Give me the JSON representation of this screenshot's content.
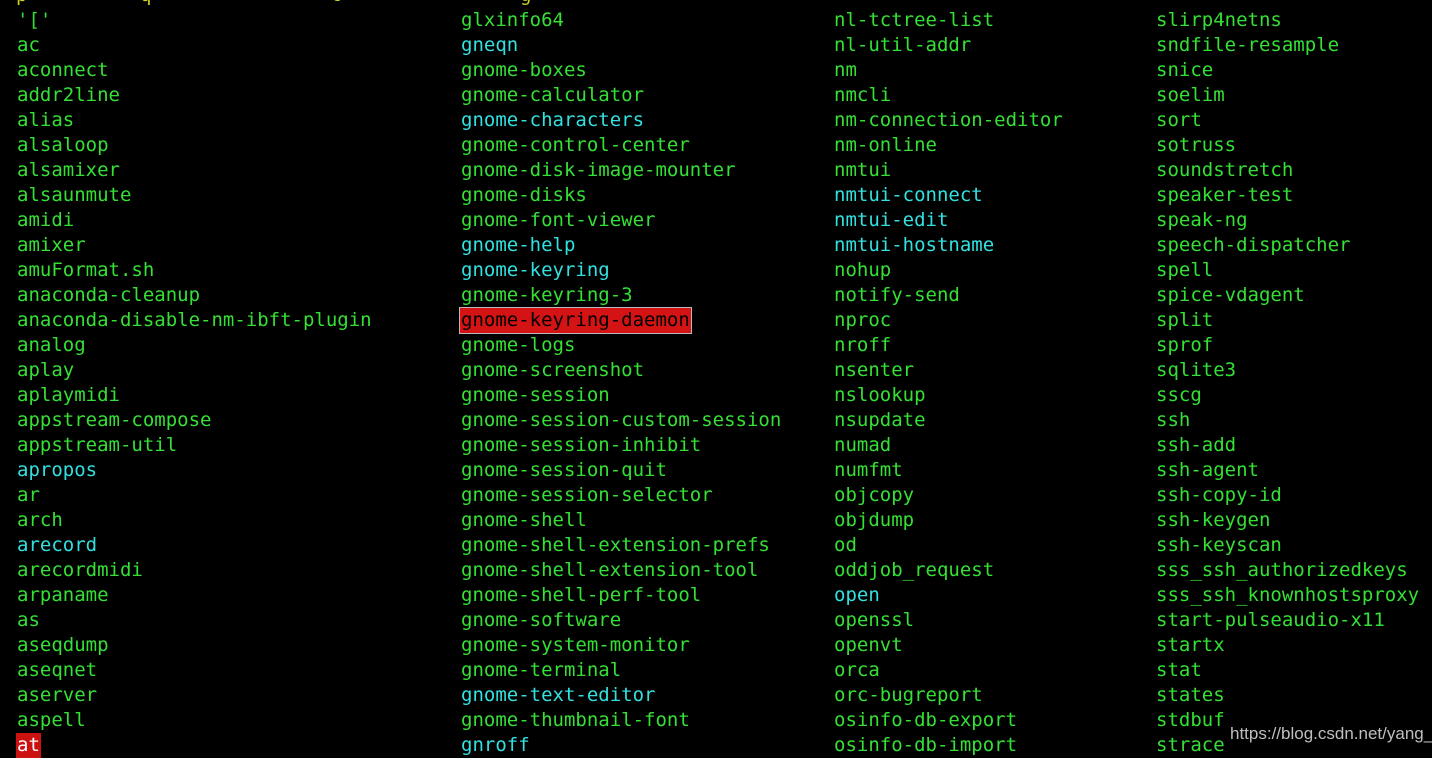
{
  "terminal": {
    "background": "#000000",
    "default_color": "#35e035",
    "symlink_color": "#33e0e0",
    "highlight_bg": "#d41414",
    "highlight_fg": "#000000",
    "cursor_bg": "#cc1111",
    "cursor_fg": "#ffffff",
    "partial_top_row": "p  q  t"
  },
  "watermark": {
    "text": "https://blog.csdn.net/yang_tu"
  },
  "columns": [
    {
      "name": "column-1",
      "items": [
        {
          "label": "'['",
          "style": "plain"
        },
        {
          "label": "ac",
          "style": "plain"
        },
        {
          "label": "aconnect",
          "style": "plain"
        },
        {
          "label": "addr2line",
          "style": "plain"
        },
        {
          "label": "alias",
          "style": "plain"
        },
        {
          "label": "alsaloop",
          "style": "plain"
        },
        {
          "label": "alsamixer",
          "style": "plain"
        },
        {
          "label": "alsaunmute",
          "style": "plain"
        },
        {
          "label": "amidi",
          "style": "plain"
        },
        {
          "label": "amixer",
          "style": "plain"
        },
        {
          "label": "amuFormat.sh",
          "style": "plain"
        },
        {
          "label": "anaconda-cleanup",
          "style": "plain"
        },
        {
          "label": "anaconda-disable-nm-ibft-plugin",
          "style": "plain"
        },
        {
          "label": "analog",
          "style": "plain"
        },
        {
          "label": "aplay",
          "style": "plain"
        },
        {
          "label": "aplaymidi",
          "style": "plain"
        },
        {
          "label": "appstream-compose",
          "style": "plain"
        },
        {
          "label": "appstream-util",
          "style": "plain"
        },
        {
          "label": "apropos",
          "style": "link"
        },
        {
          "label": "ar",
          "style": "plain"
        },
        {
          "label": "arch",
          "style": "plain"
        },
        {
          "label": "arecord",
          "style": "link"
        },
        {
          "label": "arecordmidi",
          "style": "plain"
        },
        {
          "label": "arpaname",
          "style": "plain"
        },
        {
          "label": "as",
          "style": "plain"
        },
        {
          "label": "aseqdump",
          "style": "plain"
        },
        {
          "label": "aseqnet",
          "style": "plain"
        },
        {
          "label": "aserver",
          "style": "plain"
        },
        {
          "label": "aspell",
          "style": "plain"
        },
        {
          "label": "at",
          "style": "cursor"
        }
      ]
    },
    {
      "name": "column-2",
      "items": [
        {
          "label": "glxinfo64",
          "style": "plain"
        },
        {
          "label": "gneqn",
          "style": "link"
        },
        {
          "label": "gnome-boxes",
          "style": "plain"
        },
        {
          "label": "gnome-calculator",
          "style": "plain"
        },
        {
          "label": "gnome-characters",
          "style": "link"
        },
        {
          "label": "gnome-control-center",
          "style": "plain"
        },
        {
          "label": "gnome-disk-image-mounter",
          "style": "plain"
        },
        {
          "label": "gnome-disks",
          "style": "plain"
        },
        {
          "label": "gnome-font-viewer",
          "style": "plain"
        },
        {
          "label": "gnome-help",
          "style": "link"
        },
        {
          "label": "gnome-keyring",
          "style": "link"
        },
        {
          "label": "gnome-keyring-3",
          "style": "plain"
        },
        {
          "label": "gnome-keyring-daemon",
          "style": "match"
        },
        {
          "label": "gnome-logs",
          "style": "plain"
        },
        {
          "label": "gnome-screenshot",
          "style": "plain"
        },
        {
          "label": "gnome-session",
          "style": "plain"
        },
        {
          "label": "gnome-session-custom-session",
          "style": "plain"
        },
        {
          "label": "gnome-session-inhibit",
          "style": "plain"
        },
        {
          "label": "gnome-session-quit",
          "style": "plain"
        },
        {
          "label": "gnome-session-selector",
          "style": "plain"
        },
        {
          "label": "gnome-shell",
          "style": "plain"
        },
        {
          "label": "gnome-shell-extension-prefs",
          "style": "plain"
        },
        {
          "label": "gnome-shell-extension-tool",
          "style": "plain"
        },
        {
          "label": "gnome-shell-perf-tool",
          "style": "plain"
        },
        {
          "label": "gnome-software",
          "style": "plain"
        },
        {
          "label": "gnome-system-monitor",
          "style": "plain"
        },
        {
          "label": "gnome-terminal",
          "style": "plain"
        },
        {
          "label": "gnome-text-editor",
          "style": "link"
        },
        {
          "label": "gnome-thumbnail-font",
          "style": "plain"
        },
        {
          "label": "gnroff",
          "style": "link"
        }
      ]
    },
    {
      "name": "column-3",
      "items": [
        {
          "label": "nl-tctree-list",
          "style": "plain"
        },
        {
          "label": "nl-util-addr",
          "style": "plain"
        },
        {
          "label": "nm",
          "style": "plain"
        },
        {
          "label": "nmcli",
          "style": "plain"
        },
        {
          "label": "nm-connection-editor",
          "style": "plain"
        },
        {
          "label": "nm-online",
          "style": "plain"
        },
        {
          "label": "nmtui",
          "style": "plain"
        },
        {
          "label": "nmtui-connect",
          "style": "link"
        },
        {
          "label": "nmtui-edit",
          "style": "link"
        },
        {
          "label": "nmtui-hostname",
          "style": "link"
        },
        {
          "label": "nohup",
          "style": "plain"
        },
        {
          "label": "notify-send",
          "style": "plain"
        },
        {
          "label": "nproc",
          "style": "plain"
        },
        {
          "label": "nroff",
          "style": "plain"
        },
        {
          "label": "nsenter",
          "style": "plain"
        },
        {
          "label": "nslookup",
          "style": "plain"
        },
        {
          "label": "nsupdate",
          "style": "plain"
        },
        {
          "label": "numad",
          "style": "plain"
        },
        {
          "label": "numfmt",
          "style": "plain"
        },
        {
          "label": "objcopy",
          "style": "plain"
        },
        {
          "label": "objdump",
          "style": "plain"
        },
        {
          "label": "od",
          "style": "plain"
        },
        {
          "label": "oddjob_request",
          "style": "plain"
        },
        {
          "label": "open",
          "style": "link"
        },
        {
          "label": "openssl",
          "style": "plain"
        },
        {
          "label": "openvt",
          "style": "plain"
        },
        {
          "label": "orca",
          "style": "plain"
        },
        {
          "label": "orc-bugreport",
          "style": "plain"
        },
        {
          "label": "osinfo-db-export",
          "style": "plain"
        },
        {
          "label": "osinfo-db-import",
          "style": "plain"
        }
      ]
    },
    {
      "name": "column-4",
      "items": [
        {
          "label": "slirp4netns",
          "style": "plain"
        },
        {
          "label": "sndfile-resample",
          "style": "plain"
        },
        {
          "label": "snice",
          "style": "plain"
        },
        {
          "label": "soelim",
          "style": "plain"
        },
        {
          "label": "sort",
          "style": "plain"
        },
        {
          "label": "sotruss",
          "style": "plain"
        },
        {
          "label": "soundstretch",
          "style": "plain"
        },
        {
          "label": "speaker-test",
          "style": "plain"
        },
        {
          "label": "speak-ng",
          "style": "plain"
        },
        {
          "label": "speech-dispatcher",
          "style": "plain"
        },
        {
          "label": "spell",
          "style": "plain"
        },
        {
          "label": "spice-vdagent",
          "style": "plain"
        },
        {
          "label": "split",
          "style": "plain"
        },
        {
          "label": "sprof",
          "style": "plain"
        },
        {
          "label": "sqlite3",
          "style": "plain"
        },
        {
          "label": "sscg",
          "style": "plain"
        },
        {
          "label": "ssh",
          "style": "plain"
        },
        {
          "label": "ssh-add",
          "style": "plain"
        },
        {
          "label": "ssh-agent",
          "style": "plain"
        },
        {
          "label": "ssh-copy-id",
          "style": "plain"
        },
        {
          "label": "ssh-keygen",
          "style": "plain"
        },
        {
          "label": "ssh-keyscan",
          "style": "plain"
        },
        {
          "label": "sss_ssh_authorizedkeys",
          "style": "plain"
        },
        {
          "label": "sss_ssh_knownhostsproxy",
          "style": "plain"
        },
        {
          "label": "start-pulseaudio-x11",
          "style": "plain"
        },
        {
          "label": "startx",
          "style": "plain"
        },
        {
          "label": "stat",
          "style": "plain"
        },
        {
          "label": "states",
          "style": "plain"
        },
        {
          "label": "stdbuf",
          "style": "plain"
        },
        {
          "label": "strace",
          "style": "plain"
        }
      ]
    }
  ]
}
